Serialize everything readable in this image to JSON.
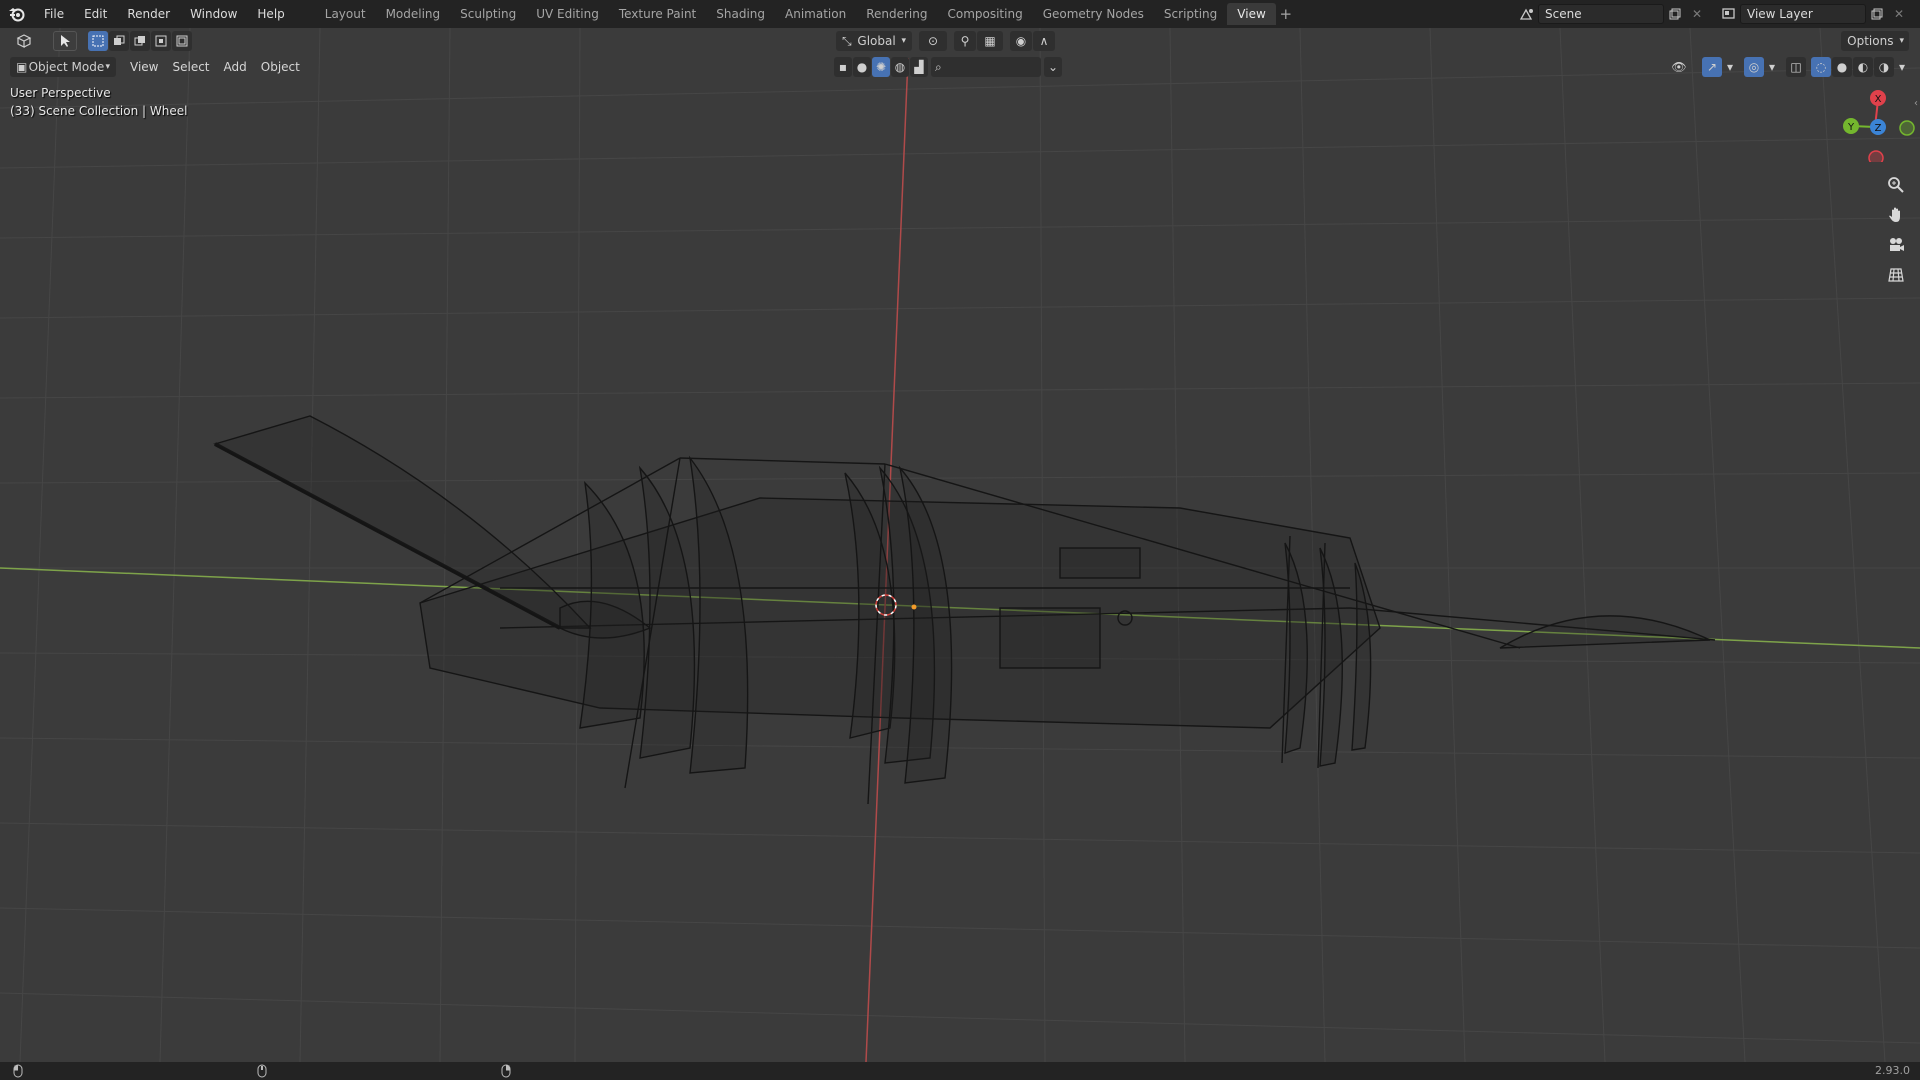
{
  "topbar": {
    "menus": [
      "File",
      "Edit",
      "Render",
      "Window",
      "Help"
    ],
    "workspaces": [
      "Layout",
      "Modeling",
      "Sculpting",
      "UV Editing",
      "Texture Paint",
      "Shading",
      "Animation",
      "Rendering",
      "Compositing",
      "Geometry Nodes",
      "Scripting",
      "View"
    ],
    "active_workspace": "View",
    "scene_name": "Scene",
    "view_layer_name": "View Layer"
  },
  "viewport_header": {
    "transform_orientation": "Global",
    "options_label": "Options",
    "mode": "Object Mode",
    "menus": [
      "View",
      "Select",
      "Add",
      "Object"
    ]
  },
  "viewport": {
    "perspective_label": "User Perspective",
    "collection_label": "(33) Scene Collection | Wheel"
  },
  "gizmo": {
    "x_label": "X",
    "y_label": "Y",
    "z_label": "Z",
    "x_color": "#e0414b",
    "y_color": "#74b72e",
    "z_color": "#3b84d6"
  },
  "statusbar": {
    "version": "2.93.0"
  },
  "icons": {
    "logo": "blender-logo-icon",
    "editor_type": "3d-viewport-icon",
    "select_tool": "cursor-icon",
    "zoom": "zoom-icon",
    "pan": "hand-icon",
    "camera": "camera-icon",
    "ortho": "grid-icon"
  }
}
